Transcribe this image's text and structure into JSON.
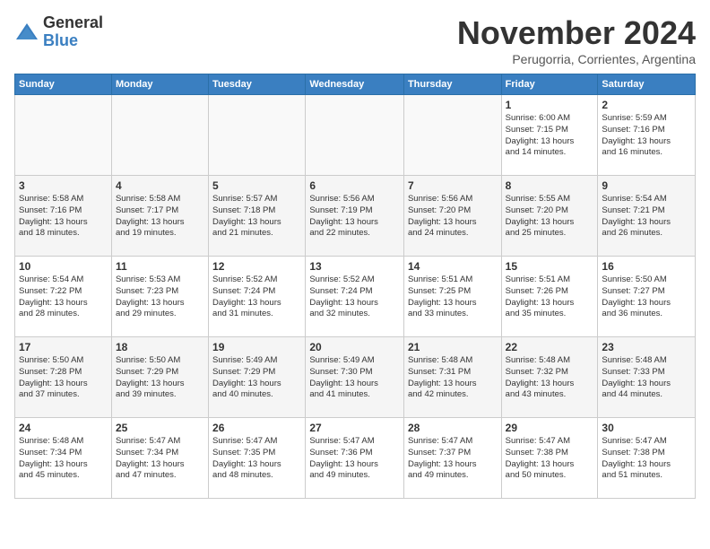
{
  "logo": {
    "general": "General",
    "blue": "Blue"
  },
  "title": "November 2024",
  "subtitle": "Perugorria, Corrientes, Argentina",
  "weekdays": [
    "Sunday",
    "Monday",
    "Tuesday",
    "Wednesday",
    "Thursday",
    "Friday",
    "Saturday"
  ],
  "weeks": [
    [
      {
        "day": "",
        "info": ""
      },
      {
        "day": "",
        "info": ""
      },
      {
        "day": "",
        "info": ""
      },
      {
        "day": "",
        "info": ""
      },
      {
        "day": "",
        "info": ""
      },
      {
        "day": "1",
        "info": "Sunrise: 6:00 AM\nSunset: 7:15 PM\nDaylight: 13 hours\nand 14 minutes."
      },
      {
        "day": "2",
        "info": "Sunrise: 5:59 AM\nSunset: 7:16 PM\nDaylight: 13 hours\nand 16 minutes."
      }
    ],
    [
      {
        "day": "3",
        "info": "Sunrise: 5:58 AM\nSunset: 7:16 PM\nDaylight: 13 hours\nand 18 minutes."
      },
      {
        "day": "4",
        "info": "Sunrise: 5:58 AM\nSunset: 7:17 PM\nDaylight: 13 hours\nand 19 minutes."
      },
      {
        "day": "5",
        "info": "Sunrise: 5:57 AM\nSunset: 7:18 PM\nDaylight: 13 hours\nand 21 minutes."
      },
      {
        "day": "6",
        "info": "Sunrise: 5:56 AM\nSunset: 7:19 PM\nDaylight: 13 hours\nand 22 minutes."
      },
      {
        "day": "7",
        "info": "Sunrise: 5:56 AM\nSunset: 7:20 PM\nDaylight: 13 hours\nand 24 minutes."
      },
      {
        "day": "8",
        "info": "Sunrise: 5:55 AM\nSunset: 7:20 PM\nDaylight: 13 hours\nand 25 minutes."
      },
      {
        "day": "9",
        "info": "Sunrise: 5:54 AM\nSunset: 7:21 PM\nDaylight: 13 hours\nand 26 minutes."
      }
    ],
    [
      {
        "day": "10",
        "info": "Sunrise: 5:54 AM\nSunset: 7:22 PM\nDaylight: 13 hours\nand 28 minutes."
      },
      {
        "day": "11",
        "info": "Sunrise: 5:53 AM\nSunset: 7:23 PM\nDaylight: 13 hours\nand 29 minutes."
      },
      {
        "day": "12",
        "info": "Sunrise: 5:52 AM\nSunset: 7:24 PM\nDaylight: 13 hours\nand 31 minutes."
      },
      {
        "day": "13",
        "info": "Sunrise: 5:52 AM\nSunset: 7:24 PM\nDaylight: 13 hours\nand 32 minutes."
      },
      {
        "day": "14",
        "info": "Sunrise: 5:51 AM\nSunset: 7:25 PM\nDaylight: 13 hours\nand 33 minutes."
      },
      {
        "day": "15",
        "info": "Sunrise: 5:51 AM\nSunset: 7:26 PM\nDaylight: 13 hours\nand 35 minutes."
      },
      {
        "day": "16",
        "info": "Sunrise: 5:50 AM\nSunset: 7:27 PM\nDaylight: 13 hours\nand 36 minutes."
      }
    ],
    [
      {
        "day": "17",
        "info": "Sunrise: 5:50 AM\nSunset: 7:28 PM\nDaylight: 13 hours\nand 37 minutes."
      },
      {
        "day": "18",
        "info": "Sunrise: 5:50 AM\nSunset: 7:29 PM\nDaylight: 13 hours\nand 39 minutes."
      },
      {
        "day": "19",
        "info": "Sunrise: 5:49 AM\nSunset: 7:29 PM\nDaylight: 13 hours\nand 40 minutes."
      },
      {
        "day": "20",
        "info": "Sunrise: 5:49 AM\nSunset: 7:30 PM\nDaylight: 13 hours\nand 41 minutes."
      },
      {
        "day": "21",
        "info": "Sunrise: 5:48 AM\nSunset: 7:31 PM\nDaylight: 13 hours\nand 42 minutes."
      },
      {
        "day": "22",
        "info": "Sunrise: 5:48 AM\nSunset: 7:32 PM\nDaylight: 13 hours\nand 43 minutes."
      },
      {
        "day": "23",
        "info": "Sunrise: 5:48 AM\nSunset: 7:33 PM\nDaylight: 13 hours\nand 44 minutes."
      }
    ],
    [
      {
        "day": "24",
        "info": "Sunrise: 5:48 AM\nSunset: 7:34 PM\nDaylight: 13 hours\nand 45 minutes."
      },
      {
        "day": "25",
        "info": "Sunrise: 5:47 AM\nSunset: 7:34 PM\nDaylight: 13 hours\nand 47 minutes."
      },
      {
        "day": "26",
        "info": "Sunrise: 5:47 AM\nSunset: 7:35 PM\nDaylight: 13 hours\nand 48 minutes."
      },
      {
        "day": "27",
        "info": "Sunrise: 5:47 AM\nSunset: 7:36 PM\nDaylight: 13 hours\nand 49 minutes."
      },
      {
        "day": "28",
        "info": "Sunrise: 5:47 AM\nSunset: 7:37 PM\nDaylight: 13 hours\nand 49 minutes."
      },
      {
        "day": "29",
        "info": "Sunrise: 5:47 AM\nSunset: 7:38 PM\nDaylight: 13 hours\nand 50 minutes."
      },
      {
        "day": "30",
        "info": "Sunrise: 5:47 AM\nSunset: 7:38 PM\nDaylight: 13 hours\nand 51 minutes."
      }
    ]
  ]
}
